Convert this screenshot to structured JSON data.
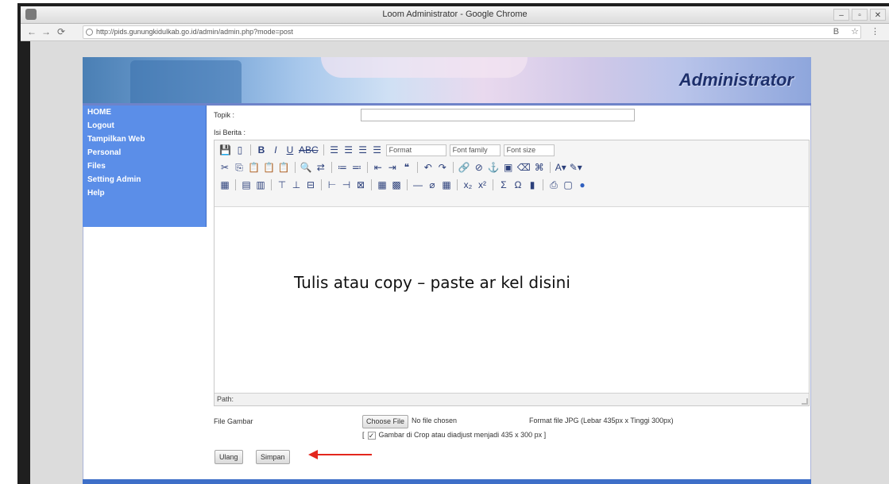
{
  "window": {
    "title": "Loom Administrator - Google Chrome",
    "controls": [
      "–",
      "▫",
      "✕"
    ]
  },
  "browser": {
    "url": "http://pids.gunungkidulkab.go.id/admin/admin.php?mode=post",
    "right_icons": "B ☆ ⋮"
  },
  "banner": {
    "title": "Administrator"
  },
  "sidebar": {
    "items": [
      {
        "label": "HOME"
      },
      {
        "label": "Logout"
      },
      {
        "label": "Tampilkan Web"
      },
      {
        "label": "Personal"
      },
      {
        "label": "Files"
      },
      {
        "label": "Setting Admin"
      },
      {
        "label": "Help"
      }
    ]
  },
  "form": {
    "topik_label": "Topik :",
    "topik_value": "",
    "isi_label": "Isi Berita :",
    "path_label": "Path:",
    "file_label": "File Gambar",
    "choose_file": "Choose File",
    "no_file": "No file chosen",
    "format_note": "Format file JPG (Lebar 435px x Tinggi 300px)",
    "crop_note_pre": "[",
    "crop_note": "Gambar di Crop atau diadjust menjadi 435 x 300 px ]",
    "ulang": "Ulang",
    "simpan": "Simpan"
  },
  "toolbar": {
    "format": "Format",
    "font_family": "Font family",
    "font_size": "Font size"
  },
  "overlay": {
    "instruction": "Tulis atau copy – paste ar  kel disini"
  },
  "colors": {
    "sidebar_bg": "#5b8ee8",
    "arrow": "#e3261d",
    "banner_title": "#1d2f6b"
  }
}
